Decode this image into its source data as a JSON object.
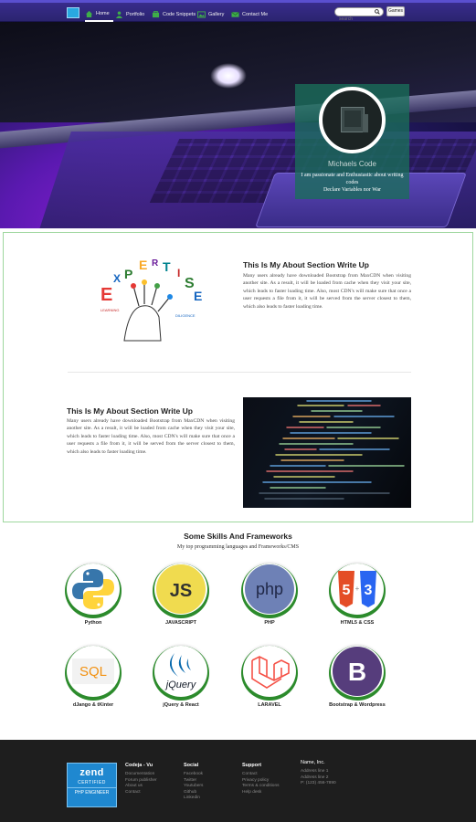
{
  "nav": {
    "items": [
      {
        "label": "Home",
        "icon": "home-icon"
      },
      {
        "label": "Portfolio",
        "icon": "portfolio-icon"
      },
      {
        "label": "Code Snippets",
        "icon": "code-icon"
      },
      {
        "label": "Gallery",
        "icon": "gallery-icon"
      },
      {
        "label": "Contact Me",
        "icon": "mail-icon"
      }
    ],
    "search_placeholder": "search",
    "games_label": "Games"
  },
  "profile": {
    "name": "Michaels Code",
    "description": "I am passionate and Enthusiastic about writing codes",
    "tagline": "Declare Variables nor War"
  },
  "about": {
    "title": "This Is My About Section Write Up",
    "text": "Many users already have downloaded Bootstrap from MaxCDN when visiting another site. As a result, it will be loaded from cache when they visit your site, which leads to faster loading time. Also, most CDN's will make sure that once a user requests a file from it, it will be served from the server closest to them, which also leads to faster loading time.",
    "second_title": "This Is My About Section Write Up",
    "second_text": "Many users already have downloaded Bootstrap from MaxCDN when visiting another site. As a result, it will be loaded from cache when they visit your site, which leads to faster loading time. Also, most CDN's will make sure that once a user requests a file from it, it will be served from the server closest to them, which also leads to faster loading time."
  },
  "skills": {
    "title": "Some Skills And Frameworks",
    "subtitle": "My top programming languages and Frameworks/CMS",
    "items": [
      {
        "label": "Python"
      },
      {
        "label": "JAVASCRIPT"
      },
      {
        "label": "PHP"
      },
      {
        "label": "HTML5 & CSS"
      },
      {
        "label": "dJango & tKinter"
      },
      {
        "label": "jQuery & React"
      },
      {
        "label": "LARAVEL"
      },
      {
        "label": "Bootstrap & Wordpress"
      }
    ]
  },
  "footer": {
    "cert": {
      "brand": "zend",
      "line1": "CERTIFIED",
      "line2": "PHP ENGINEER"
    },
    "columns": [
      {
        "heading": "Codeja - Vu",
        "items": [
          "Documentation",
          "Forum publisher",
          "About us",
          "Contact"
        ]
      },
      {
        "heading": "Social",
        "items": [
          "Facebook",
          "Twitter",
          "Youtubers",
          "Github",
          "Linkedin"
        ]
      },
      {
        "heading": "Support",
        "items": [
          "Contact",
          "Privacy policy",
          "Terms & conditions",
          "Help desk"
        ]
      },
      {
        "heading": "Name, Inc.",
        "items": [
          "Address line 1",
          "Address line 2",
          "P: (123) 456-7890"
        ]
      }
    ]
  }
}
